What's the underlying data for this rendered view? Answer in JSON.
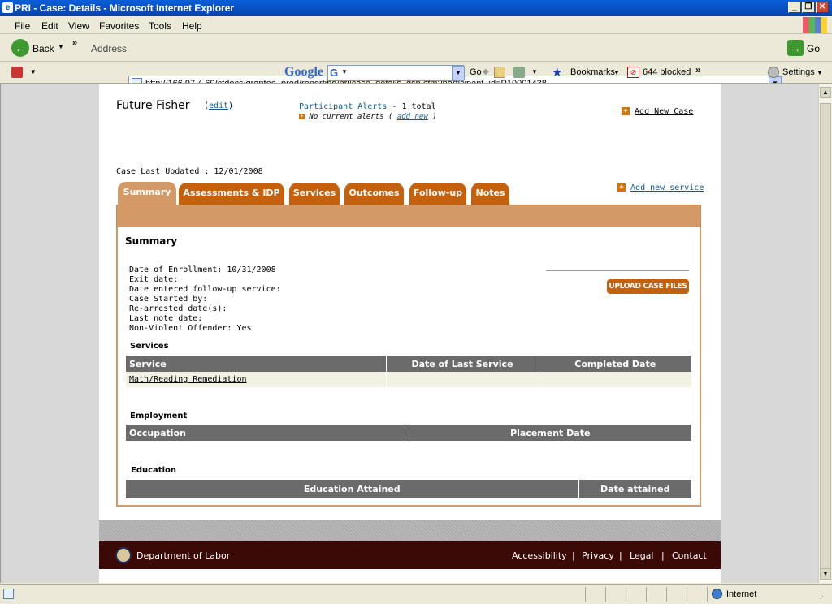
{
  "window": {
    "title": "PRI - Case: Details - Microsoft Internet Explorer"
  },
  "menu": {
    "items": [
      "File",
      "Edit",
      "View",
      "Favorites",
      "Tools",
      "Help"
    ]
  },
  "toolbar": {
    "back_label": "Back",
    "address_label": "Address",
    "url": "http://166.97.4.69/cfdocs/grantee_prod/reporting/pri/case_details_dsp.cfm?participant_id=P10001438",
    "go_label": "Go"
  },
  "googlebar": {
    "logo": "Google",
    "go_label": "Go",
    "bookmarks_label": "Bookmarks",
    "blocked_label": "644 blocked",
    "settings_label": "Settings"
  },
  "participant": {
    "name": "Future Fisher",
    "edit_label": "edit",
    "alerts_link": "Participant Alerts",
    "alerts_total": "- 1 total",
    "no_alerts": "No current alerts",
    "add_new_label": "add new",
    "add_new_case": "Add New Case"
  },
  "case": {
    "last_updated": "Case Last Updated : 12/01/2008",
    "add_new_service": "Add new service"
  },
  "tabs": [
    "Summary",
    "Assessments & IDP",
    "Services",
    "Outcomes",
    "Follow-up",
    "Notes"
  ],
  "summary": {
    "heading": "Summary",
    "fields": [
      "Date of Enrollment: 10/31/2008",
      "Exit date:",
      "Date entered follow-up service:",
      "Case Started by:",
      "Re-arrested date(s):",
      "Last note date:",
      "Non-Violent Offender: Yes"
    ],
    "upload_label": "UPLOAD CASE FILES"
  },
  "services": {
    "heading": "Services",
    "columns": [
      "Service",
      "Date of Last Service",
      "Completed Date"
    ],
    "rows": [
      {
        "service": "Math/Reading Remediation",
        "last": "",
        "completed": ""
      }
    ]
  },
  "employment": {
    "heading": "Employment",
    "columns": [
      "Occupation",
      "Placement Date"
    ]
  },
  "education": {
    "heading": "Education",
    "columns": [
      "Education Attained",
      "Date attained"
    ]
  },
  "footer": {
    "org": "Department of Labor",
    "links": [
      "Accessibility",
      "Privacy",
      "Legal",
      "Contact"
    ]
  },
  "status": {
    "zone": "Internet"
  }
}
